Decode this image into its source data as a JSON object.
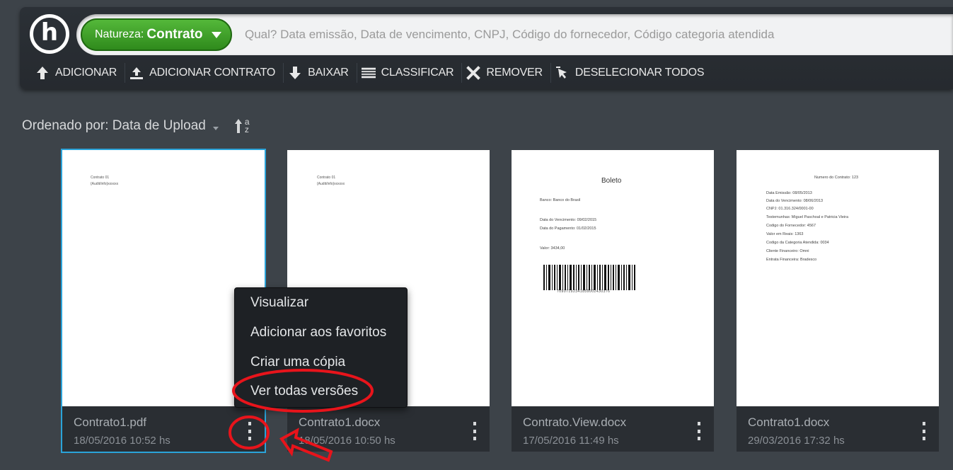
{
  "header": {
    "filter": {
      "key": "Natureza:",
      "value": "Contrato"
    },
    "search_placeholder": "Qual? Data emissão, Data de vencimento, CNPJ, Código do fornecedor, Código categoria atendida"
  },
  "toolbar": {
    "items": [
      {
        "label": "ADICIONAR",
        "icon": "arrow-up-icon"
      },
      {
        "label": "ADICIONAR CONTRATO",
        "icon": "upload-icon"
      },
      {
        "label": "BAIXAR",
        "icon": "arrow-down-icon"
      },
      {
        "label": "CLASSIFICAR",
        "icon": "list-icon"
      },
      {
        "label": "REMOVER",
        "icon": "close-icon"
      },
      {
        "label": "DESELECIONAR TODOS",
        "icon": "cursor-icon"
      }
    ]
  },
  "sort": {
    "label": "Ordenado por: Data de Upload",
    "direction_top": "a",
    "direction_bottom": "z"
  },
  "documents": [
    {
      "name": "Contrato1.pdf",
      "date": "18/05/2016 10:52 hs",
      "selected": true,
      "preview": {
        "lines": [
          "Contrato 01",
          "{Audit/info}xxxxxx"
        ]
      }
    },
    {
      "name": "Contrato1.docx",
      "date": "18/05/2016 10:50 hs",
      "selected": false,
      "preview": {
        "lines": [
          "Contrato 01",
          "{Audit/info}xxxxxx"
        ]
      }
    },
    {
      "name": "Contrato.View.docx",
      "date": "17/05/2016 11:49 hs",
      "selected": false,
      "preview": {
        "title": "Boleto",
        "lines": [
          "Banco: Banco do Brasil",
          "Data do Vencimento: 09/02/2015",
          "Data do Pagamento: 01/02/2015",
          "Valor: 3434,00"
        ],
        "barcode_number": "70907192341859002430376"
      }
    },
    {
      "name": "Contrato1.docx",
      "date": "29/03/2016 17:32 hs",
      "selected": false,
      "preview": {
        "title": "Numero do Contrato: 123",
        "lines": [
          "Data Emissão: 08/05/2013",
          "Data do Vencimento: 08/06/2013",
          "CNPJ: 01.316.324/0001-00",
          "Testemunhas: Miguel Paschoal e Patricia Vieira",
          "Codigo do Fornecedor: 4567",
          "Valor em Reais: 1363",
          "Codigo da Categoria Atendida: 0034",
          "Cliente Financeiro: Omni",
          "Entrata Financeira: Bradesco"
        ]
      }
    }
  ],
  "context_menu": {
    "items": [
      "Visualizar",
      "Adicionar aos favoritos",
      "Criar uma cópia",
      "Ver todas versões"
    ]
  },
  "colors": {
    "background": "#3d4349",
    "topbar": "#2b3036",
    "filter_green": "#3d9e27",
    "selection_blue": "#2aa3d9",
    "annotation_red": "#e8141b"
  }
}
